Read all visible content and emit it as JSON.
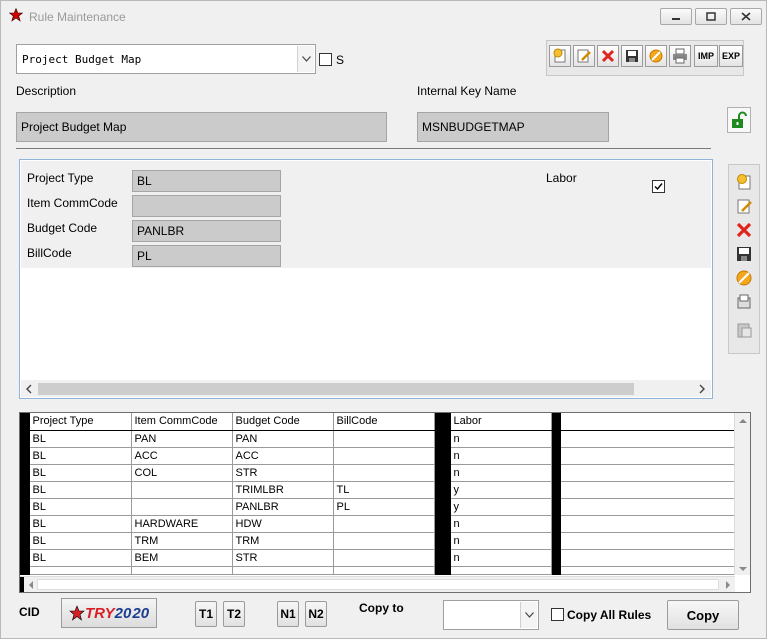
{
  "window": {
    "title": "Rule Maintenance"
  },
  "rule_select": {
    "value": "Project Budget Map"
  },
  "s_checkbox": {
    "label": "S",
    "checked": false
  },
  "description": {
    "label": "Description",
    "value": "Project Budget Map"
  },
  "internal_key": {
    "label": "Internal Key Name",
    "value": "MSNBUDGETMAP"
  },
  "toolbar": {
    "imp_label": "IMP",
    "exp_label": "EXP"
  },
  "detail": {
    "project_type": {
      "label": "Project Type",
      "value": "BL"
    },
    "item_commcode": {
      "label": "Item CommCode",
      "value": ""
    },
    "budget_code": {
      "label": "Budget Code",
      "value": "PANLBR"
    },
    "billcode": {
      "label": "BillCode",
      "value": "PL"
    },
    "labor": {
      "label": "Labor",
      "checked": true
    }
  },
  "grid": {
    "columns": [
      "Project Type",
      "Item CommCode",
      "Budget Code",
      "BillCode",
      "Labor"
    ],
    "rows": [
      [
        "BL",
        "PAN",
        "PAN",
        "",
        "n"
      ],
      [
        "BL",
        "ACC",
        "ACC",
        "",
        "n"
      ],
      [
        "BL",
        "COL",
        "STR",
        "",
        "n"
      ],
      [
        "BL",
        "",
        "TRIMLBR",
        "TL",
        "y"
      ],
      [
        "BL",
        "",
        "PANLBR",
        "PL",
        "y"
      ],
      [
        "BL",
        "HARDWARE",
        "HDW",
        "",
        "n"
      ],
      [
        "BL",
        "TRM",
        "TRM",
        "",
        "n"
      ],
      [
        "BL",
        "BEM",
        "STR",
        "",
        "n"
      ]
    ]
  },
  "footer": {
    "cid_label": "CID",
    "logo_text_try": "TRY",
    "logo_text_20a": "20",
    "logo_text_20b": "20",
    "t1": "T1",
    "t2": "T2",
    "n1": "N1",
    "n2": "N2",
    "copy_to_label": "Copy to",
    "copy_to_value": "",
    "copy_all_label": "Copy All Rules",
    "copy_button": "Copy"
  }
}
